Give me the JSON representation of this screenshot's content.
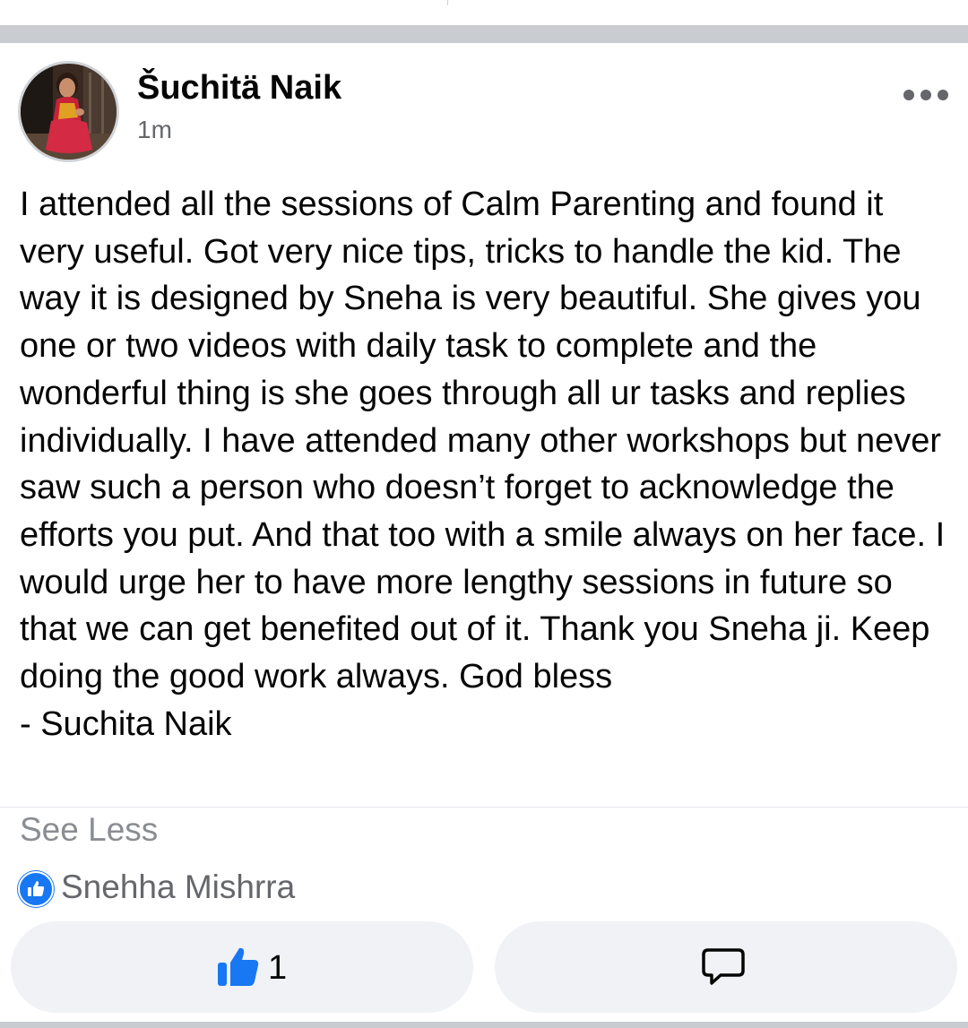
{
  "post": {
    "author": "Šuchitä Naik",
    "timestamp": "1m",
    "text": "I attended all the sessions of Calm Parenting and found it very useful. Got very nice tips, tricks to handle the kid. The way it is designed by Sneha is very beautiful. She gives you one or two videos with daily task to complete and the wonderful thing is she goes through all ur tasks and replies individually. I have attended many other workshops but never saw such a person who doesn’t forget to acknowledge the efforts you put. And that too with a smile always on her face. I would urge her to have more lengthy sessions in future so that we can get benefited out of it. Thank you Sneha ji. Keep doing the good work always. God bless\n- Suchita Naik",
    "see_less_label": "See Less"
  },
  "reactions": {
    "liker_name": "Snehha Mishrra",
    "like_count": "1"
  },
  "icons": {
    "more": "more-options-icon",
    "like": "thumbs-up-icon",
    "comment": "comment-icon",
    "badge": "like-badge-icon"
  },
  "colors": {
    "like_blue": "#1877f2",
    "secondary_text": "#65676b",
    "button_bg": "#f0f2f5",
    "separator": "#c9ccd1"
  }
}
